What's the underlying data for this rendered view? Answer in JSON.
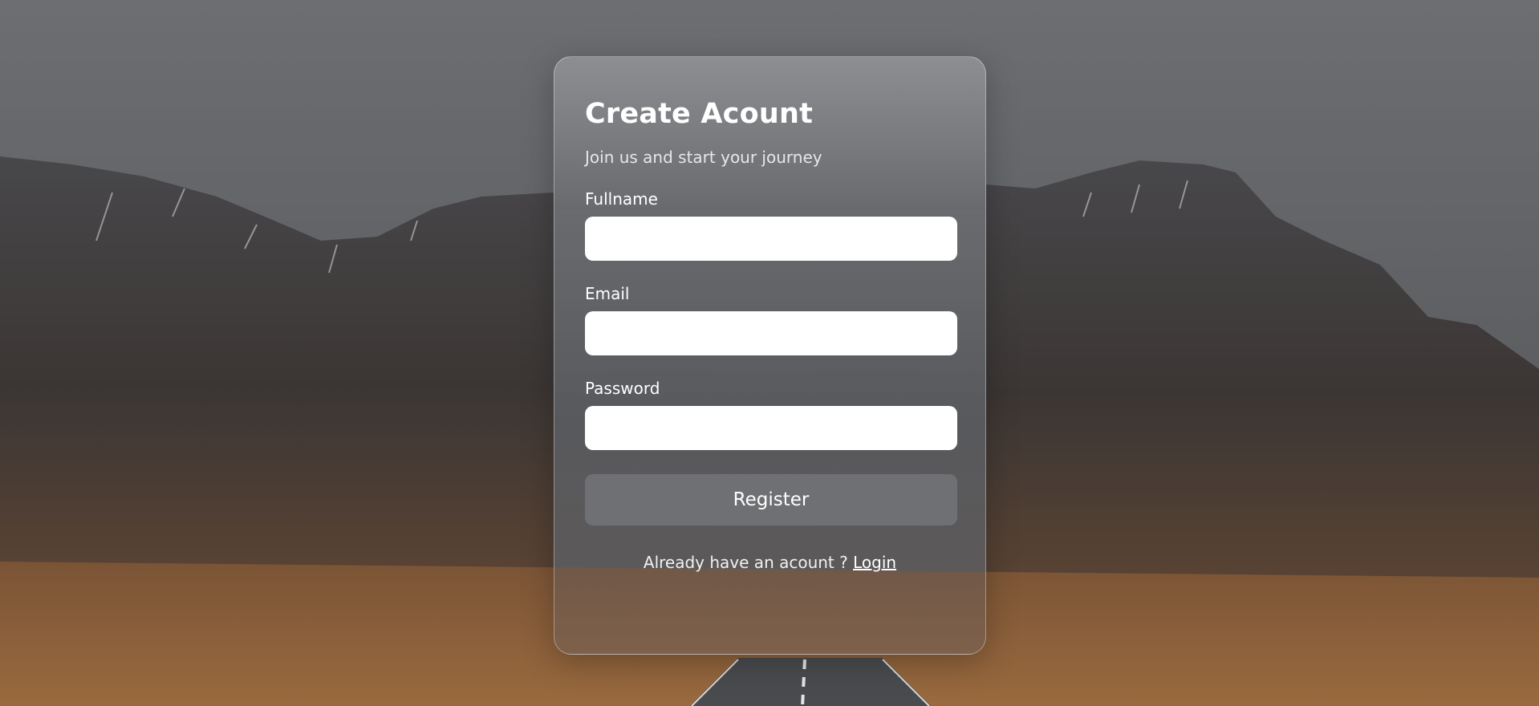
{
  "form": {
    "title": "Create Acount",
    "subtitle": "Join us and start your journey",
    "fields": [
      {
        "label": "Fullname",
        "value": ""
      },
      {
        "label": "Email",
        "value": ""
      },
      {
        "label": "Password",
        "value": ""
      }
    ],
    "submit_label": "Register",
    "footer_text": "Already have an acount ? ",
    "footer_link": "Login"
  }
}
